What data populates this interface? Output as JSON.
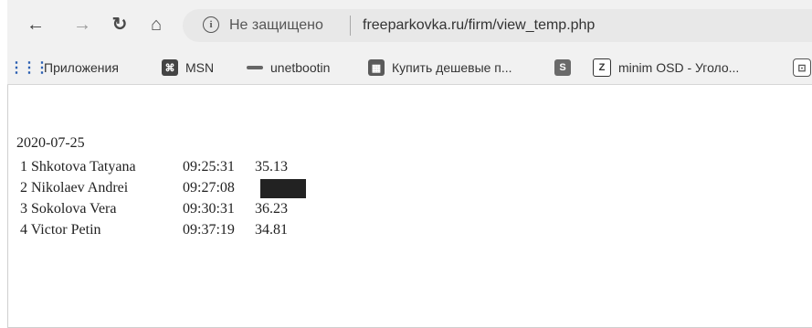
{
  "browser": {
    "security_text": "Не защищено",
    "url": "freeparkovka.ru/firm/view_temp.php"
  },
  "bookmarks": [
    {
      "label": "Приложения",
      "icon": "apps-grid-icon"
    },
    {
      "label": "MSN",
      "icon": "msn-icon"
    },
    {
      "label": "unetbootin",
      "icon": "unetbootin-icon"
    },
    {
      "label": "Купить дешевые п...",
      "icon": "shop-icon"
    },
    {
      "label": "",
      "icon": "s-icon"
    },
    {
      "label": "minim OSD - Уголо...",
      "icon": "z-icon"
    },
    {
      "label": "",
      "icon": "truncated-icon"
    }
  ],
  "page": {
    "date": "2020-07-25",
    "rows": [
      {
        "name": "1 Shkotova Tatyana",
        "time": "09:25:31",
        "temp": "35.13"
      },
      {
        "name": "2 Nikolaev Andrei",
        "time": "09:27:08",
        "temp": ""
      },
      {
        "name": "3 Sokolova Vera",
        "time": "09:30:31",
        "temp": "36.23"
      },
      {
        "name": "4 Victor Petin",
        "time": "09:37:19",
        "temp": "34.81"
      }
    ]
  }
}
